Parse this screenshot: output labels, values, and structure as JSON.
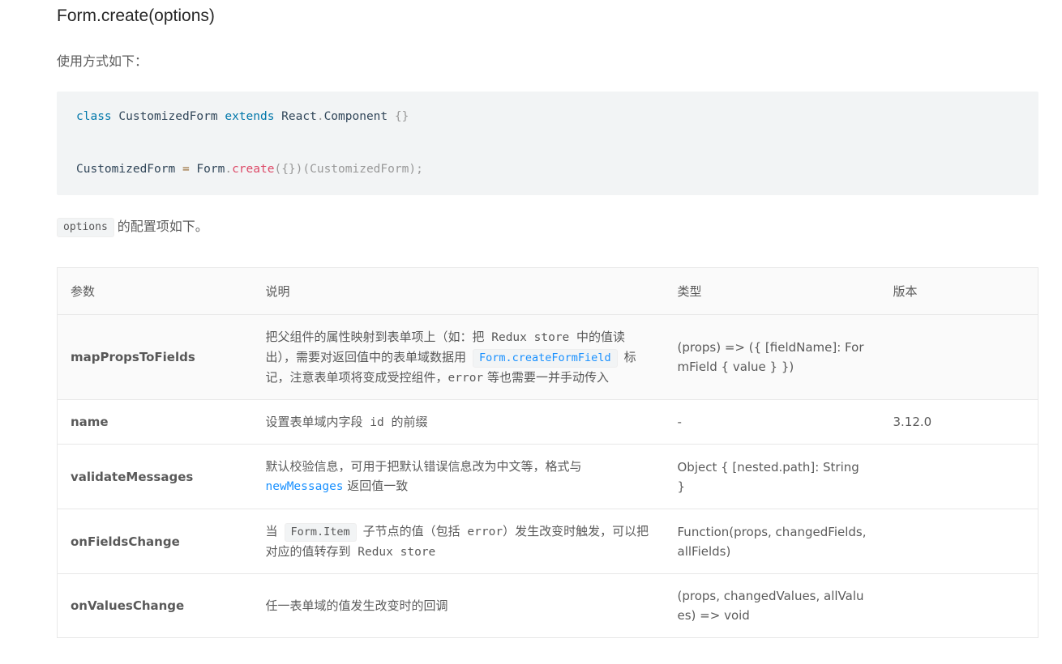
{
  "heading": "Form.create(options)",
  "intro": "使用方式如下：",
  "code": {
    "line1": {
      "kw1": "class",
      "name": " CustomizedForm ",
      "kw2": "extends",
      "rest": " React",
      "dot": ".",
      "comp": "Component ",
      "braces": "{}"
    },
    "line2": {
      "a": "CustomizedForm ",
      "eq": "=",
      "b": " Form",
      "dot": ".",
      "fn": "create",
      "c": "({})(CustomizedForm);"
    }
  },
  "options_line": {
    "code": "options",
    "text": "的配置项如下。"
  },
  "table": {
    "headers": [
      "参数",
      "说明",
      "类型",
      "版本"
    ],
    "rows": [
      {
        "param": "mapPropsToFields",
        "desc": {
          "p1": "把父组件的属性映射到表单项上（如：把",
          "m1": " Redux store ",
          "p2": "中的值读出），需要对返回值中的表单域数据用",
          "tag": "Form.createFormField",
          "p3": "标记，注意表单项将变成受控组件，",
          "m2": "error",
          "p4": " 等也需要一并手动传入"
        },
        "type": "(props) => ({ [fieldName]: FormField { value } })",
        "version": ""
      },
      {
        "param": "name",
        "desc": {
          "p1": "设置表单域内字段",
          "m1": " id ",
          "p2": "的前缀"
        },
        "type": "-",
        "version": "3.12.0"
      },
      {
        "param": "validateMessages",
        "desc": {
          "p1": "默认校验信息，可用于把默认错误信息改为中文等，格式与",
          "link": "newMessages",
          "p2": " 返回值一致"
        },
        "type": "Object { [nested.path]: String }",
        "version": ""
      },
      {
        "param": "onFieldsChange",
        "desc": {
          "p0": "当",
          "tag": "Form.Item",
          "p1": "子节点的值（包括",
          "m1": " error",
          "p2": "）发生改变时触发，可以把对应的值转存到",
          "m2": " Redux store"
        },
        "type": "Function(props, changedFields, allFields)",
        "version": ""
      },
      {
        "param": "onValuesChange",
        "desc": {
          "p1": "任一表单域的值发生改变时的回调"
        },
        "type": "(props, changedValues, allValues) => void",
        "version": ""
      }
    ]
  }
}
